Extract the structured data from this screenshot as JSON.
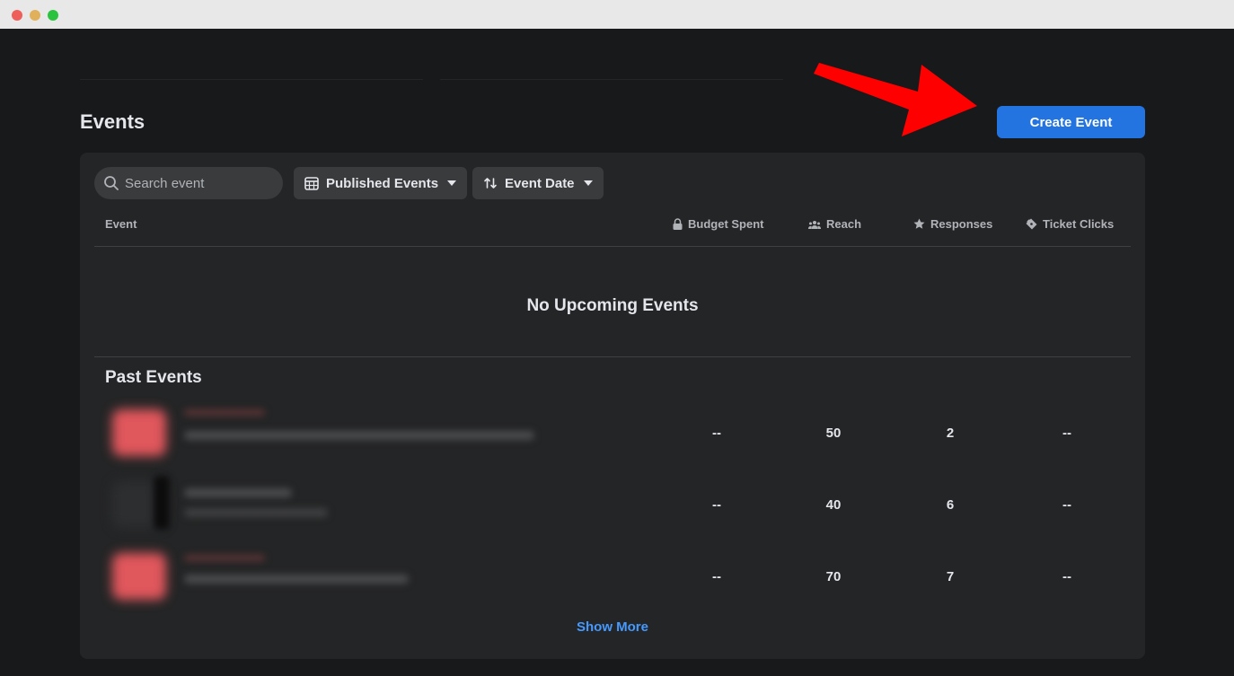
{
  "window": {
    "controls": [
      "close",
      "minimize",
      "zoom"
    ]
  },
  "header": {
    "title": "Events",
    "create_label": "Create Event"
  },
  "toolbar": {
    "search_placeholder": "Search event",
    "filter_label": "Published Events",
    "sort_label": "Event Date"
  },
  "columns": {
    "event": "Event",
    "budget": "Budget Spent",
    "reach": "Reach",
    "responses": "Responses",
    "ticket_clicks": "Ticket Clicks"
  },
  "upcoming": {
    "empty_text": "No Upcoming Events"
  },
  "past": {
    "title": "Past Events",
    "rows": [
      {
        "budget": "--",
        "reach": "50",
        "responses": "2",
        "ticket_clicks": "--"
      },
      {
        "budget": "--",
        "reach": "40",
        "responses": "6",
        "ticket_clicks": "--"
      },
      {
        "budget": "--",
        "reach": "70",
        "responses": "7",
        "ticket_clicks": "--"
      }
    ],
    "show_more": "Show More"
  },
  "colors": {
    "accent": "#2374e1",
    "link": "#4599ff",
    "annotation_arrow": "#ff0000"
  }
}
